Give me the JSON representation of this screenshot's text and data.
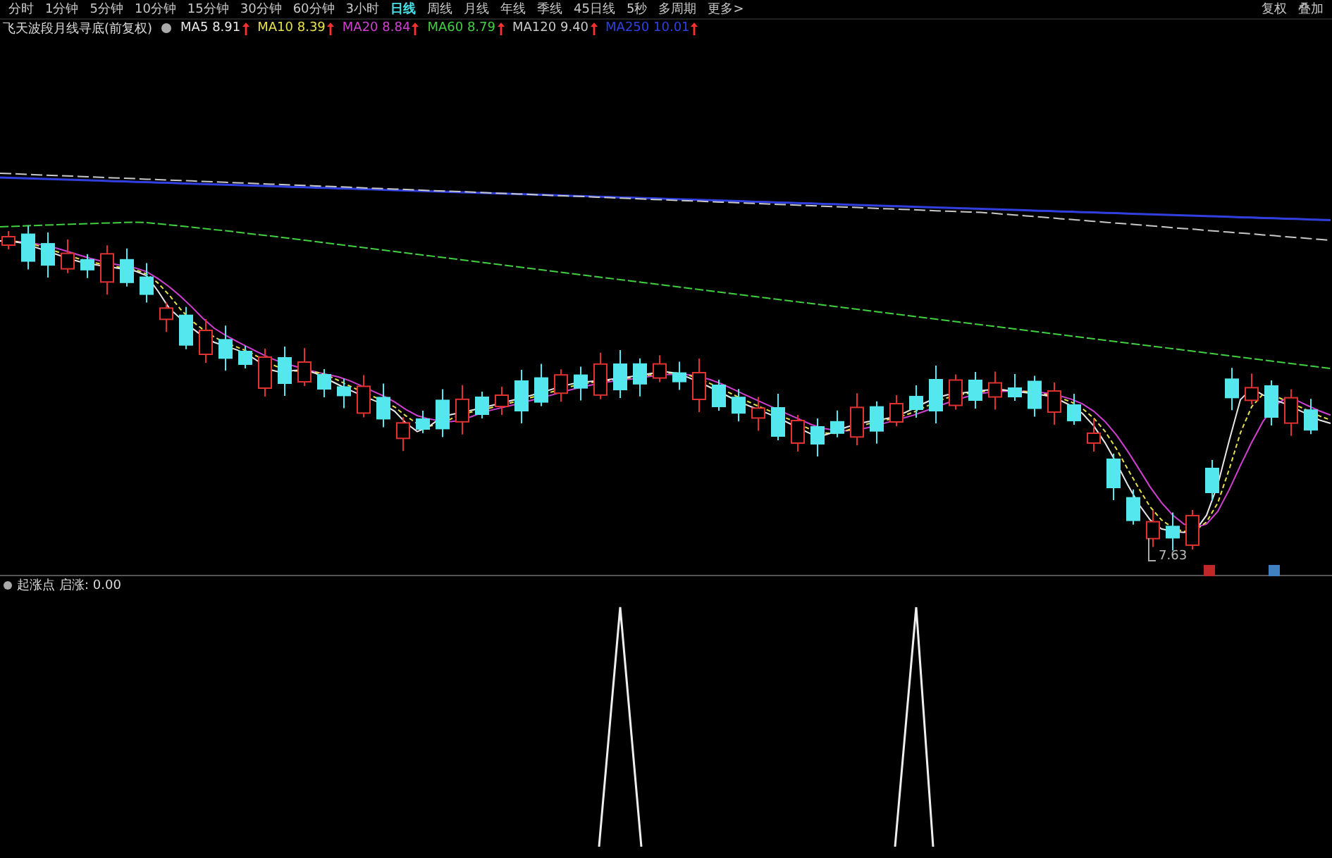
{
  "toolbar": {
    "periods": [
      {
        "label": "分时",
        "selected": false
      },
      {
        "label": "1分钟",
        "selected": false
      },
      {
        "label": "5分钟",
        "selected": false
      },
      {
        "label": "10分钟",
        "selected": false
      },
      {
        "label": "15分钟",
        "selected": false
      },
      {
        "label": "30分钟",
        "selected": false
      },
      {
        "label": "60分钟",
        "selected": false
      },
      {
        "label": "3小时",
        "selected": false
      },
      {
        "label": "日线",
        "selected": true
      },
      {
        "label": "周线",
        "selected": false
      },
      {
        "label": "月线",
        "selected": false
      },
      {
        "label": "年线",
        "selected": false
      },
      {
        "label": "季线",
        "selected": false
      },
      {
        "label": "45日线",
        "selected": false
      },
      {
        "label": "5秒",
        "selected": false
      },
      {
        "label": "多周期",
        "selected": false
      },
      {
        "label": "更多>",
        "selected": false
      }
    ],
    "actions": [
      "复权",
      "叠加"
    ]
  },
  "main_chart": {
    "title": "飞天波段月线寻底(前复权)",
    "averages": [
      {
        "name": "MA5",
        "value": "8.91",
        "color": "#e8e8e8"
      },
      {
        "name": "MA10",
        "value": "8.39",
        "color": "#e6e04a"
      },
      {
        "name": "MA20",
        "value": "8.84",
        "color": "#d040d0"
      },
      {
        "name": "MA60",
        "value": "8.79",
        "color": "#40d040"
      },
      {
        "name": "MA120",
        "value": "9.40",
        "color": "#c8c8c8"
      },
      {
        "name": "MA250",
        "value": "10.01",
        "color": "#3040e0"
      }
    ],
    "low_label": "7.63"
  },
  "sub_chart": {
    "name": "起涨点",
    "reading": "启涨: 0.00"
  }
}
